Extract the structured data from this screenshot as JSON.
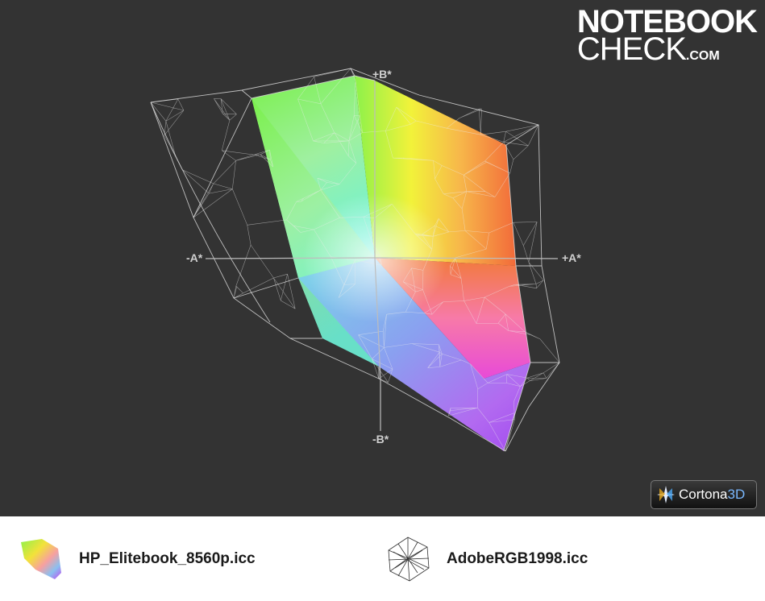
{
  "chart_data": {
    "type": "3d-gamut",
    "axis_labels": {
      "pos_b": "+B*",
      "neg_b": "-B*",
      "pos_a": "+A*",
      "neg_a": "-A*"
    },
    "legend": [
      {
        "label": "HP_Elitebook_8560p.icc",
        "style": "solid-color"
      },
      {
        "label": "AdobeRGB1998.icc",
        "style": "wireframe"
      }
    ],
    "colors": {
      "background": "#333333",
      "wireframe": "#d8d8d8",
      "legend_bg": "#ffffff"
    }
  },
  "branding": {
    "logo_line1": "NOTEBOOK",
    "logo_line2": "CHECK",
    "logo_suffix": ".COM",
    "viewer_name": "Cortona",
    "viewer_suffix": "3D"
  }
}
